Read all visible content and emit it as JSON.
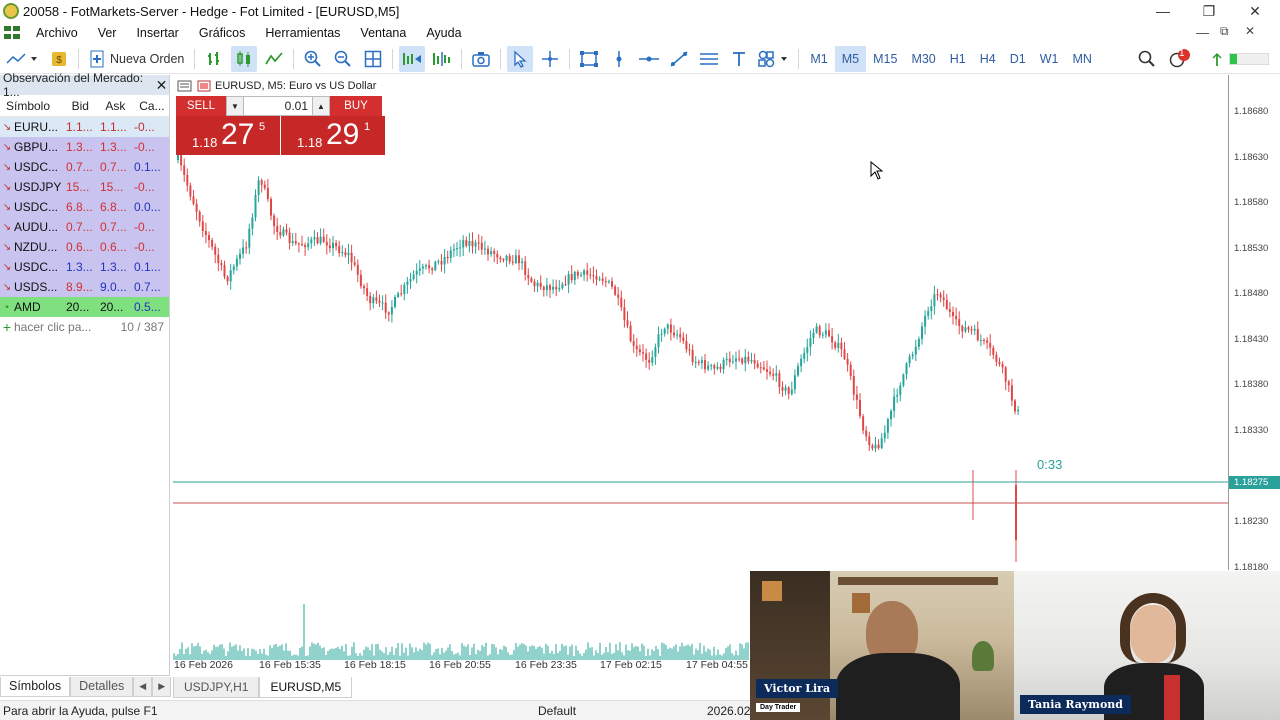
{
  "window": {
    "title": "20058 - FotMarkets-Server - Hedge - Fot Limited - [EURUSD,M5]",
    "minimize": "—",
    "restore": "❐",
    "close": "✕",
    "inner_restore": "⧉",
    "inner_close": "✕"
  },
  "menu": {
    "items": [
      "Archivo",
      "Ver",
      "Insertar",
      "Gráficos",
      "Herramientas",
      "Ventana",
      "Ayuda"
    ]
  },
  "toolbar": {
    "new_order": "Nueva Orden",
    "timeframes": [
      "M1",
      "M5",
      "M15",
      "M30",
      "H1",
      "H4",
      "D1",
      "W1",
      "MN"
    ],
    "active_timeframe": "M5",
    "notification_count": "1"
  },
  "market_watch": {
    "title": "Observación del Mercado: 1...",
    "columns": [
      "Símbolo",
      "Bid",
      "Ask",
      "Ca..."
    ],
    "rows": [
      {
        "symbol": "EURU...",
        "bid": "1.1...",
        "ask": "1.1...",
        "chg": "-0...",
        "bg": "#dbe8f6",
        "bid_color": "#c03030",
        "ask_color": "#c03030",
        "chg_color": "#c03030"
      },
      {
        "symbol": "GBPU...",
        "bid": "1.3...",
        "ask": "1.3...",
        "chg": "-0...",
        "bg": "#c9c3f0",
        "bid_color": "#d03030",
        "ask_color": "#d03030",
        "chg_color": "#d03030"
      },
      {
        "symbol": "USDC...",
        "bid": "0.7...",
        "ask": "0.7...",
        "chg": "0.1...",
        "bg": "#c9c3f0",
        "bid_color": "#d03030",
        "ask_color": "#d03030",
        "chg_color": "#2233c0"
      },
      {
        "symbol": "USDJPY",
        "bid": "15...",
        "ask": "15...",
        "chg": "-0...",
        "bg": "#c9c3f0",
        "bid_color": "#d03030",
        "ask_color": "#d03030",
        "chg_color": "#d03030"
      },
      {
        "symbol": "USDC...",
        "bid": "6.8...",
        "ask": "6.8...",
        "chg": "0.0...",
        "bg": "#c9c3f0",
        "bid_color": "#d03030",
        "ask_color": "#d03030",
        "chg_color": "#2233c0"
      },
      {
        "symbol": "AUDU...",
        "bid": "0.7...",
        "ask": "0.7...",
        "chg": "-0...",
        "bg": "#c9c3f0",
        "bid_color": "#d03030",
        "ask_color": "#d03030",
        "chg_color": "#d03030"
      },
      {
        "symbol": "NZDU...",
        "bid": "0.6...",
        "ask": "0.6...",
        "chg": "-0...",
        "bg": "#c9c3f0",
        "bid_color": "#d03030",
        "ask_color": "#d03030",
        "chg_color": "#d03030"
      },
      {
        "symbol": "USDC...",
        "bid": "1.3...",
        "ask": "1.3...",
        "chg": "0.1...",
        "bg": "#c9c3f0",
        "bid_color": "#2233c0",
        "ask_color": "#2233c0",
        "chg_color": "#2233c0"
      },
      {
        "symbol": "USDS...",
        "bid": "8.9...",
        "ask": "9.0...",
        "chg": "0.7...",
        "bg": "#c9c3f0",
        "bid_color": "#d03030",
        "ask_color": "#2233c0",
        "chg_color": "#2233c0"
      },
      {
        "symbol": "AMD",
        "bid": "20...",
        "ask": "20...",
        "chg": "0.5...",
        "bg": "#7fe07f",
        "bid_color": "#111111",
        "ask_color": "#111111",
        "chg_color": "#2233c0"
      }
    ],
    "add_hint": "hacer clic pa...",
    "count": "10 / 387"
  },
  "left_tabs": [
    "Símbolos",
    "Detalles"
  ],
  "chart": {
    "header": "EURUSD, M5:  Euro vs US Dollar",
    "sell_label": "SELL",
    "buy_label": "BUY",
    "lot": "0.01",
    "sell_price": {
      "small": "1.18",
      "big": "27",
      "sup": "5"
    },
    "buy_price": {
      "small": "1.18",
      "big": "29",
      "sup": "1"
    },
    "price_labels": [
      "1.18680",
      "1.18630",
      "1.18580",
      "1.18530",
      "1.18480",
      "1.18430",
      "1.18380",
      "1.18330",
      "1.18230",
      "1.18180"
    ],
    "current_price": "1.18275",
    "timer": "0:33",
    "time_labels": [
      "16 Feb 2026",
      "16 Feb 15:35",
      "16 Feb 18:15",
      "16 Feb 20:55",
      "16 Feb 23:35",
      "17 Feb 02:15",
      "17 Feb 04:55"
    ]
  },
  "chart_tabs": [
    "USDJPY,H1",
    "EURUSD,M5"
  ],
  "status": {
    "help": "Para abrir la Ayuda, pulse F1",
    "profile": "Default",
    "datetime": "2026.02"
  },
  "video": {
    "person1_name": "Victor Lira",
    "person1_role": "Day Trader",
    "person2_name": "Tania Raymond"
  }
}
